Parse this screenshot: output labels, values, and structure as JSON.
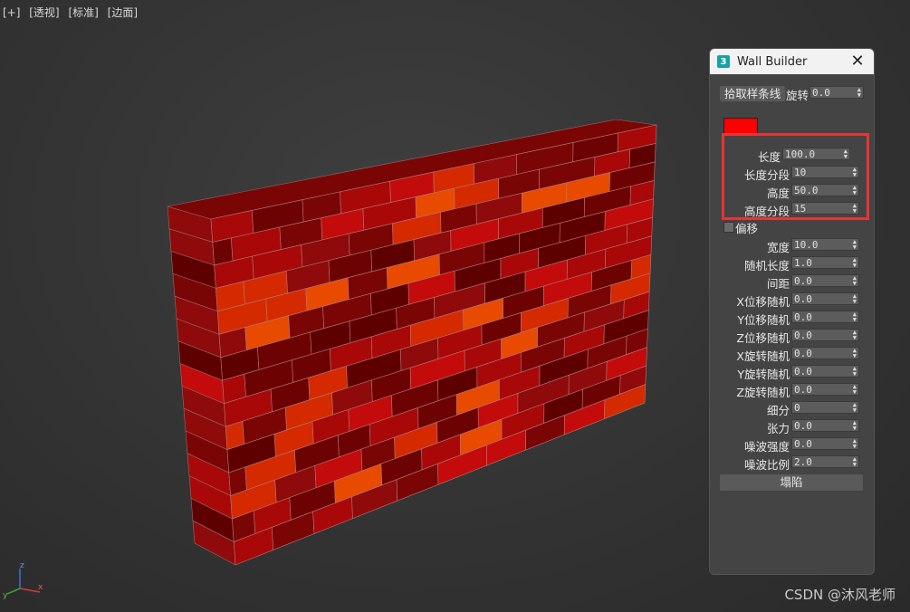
{
  "viewport": {
    "labels": [
      "[+]",
      "[透视]",
      "[标准]",
      "[边面]"
    ]
  },
  "panel": {
    "title": "Wall Builder",
    "app_icon": "3",
    "close_icon": "close-icon",
    "pick_spline_label": "拾取样条线",
    "rotation_label": "旋转",
    "rotation_value": "0.0",
    "swatch_color": "#ff0000",
    "offset_label": "偏移",
    "collapse_label": "塌陷",
    "params": [
      {
        "label": "长度",
        "value": "100.0"
      },
      {
        "label": "长度分段",
        "value": "10"
      },
      {
        "label": "高度",
        "value": "50.0"
      },
      {
        "label": "高度分段",
        "value": "15"
      },
      {
        "label": "宽度",
        "value": "10.0"
      },
      {
        "label": "随机长度",
        "value": "1.0"
      },
      {
        "label": "间距",
        "value": "0.0"
      },
      {
        "label": "X位移随机",
        "value": "0.0"
      },
      {
        "label": "Y位移随机",
        "value": "0.0"
      },
      {
        "label": "Z位移随机",
        "value": "0.0"
      },
      {
        "label": "X旋转随机",
        "value": "0.0"
      },
      {
        "label": "Y旋转随机",
        "value": "0.0"
      },
      {
        "label": "Z旋转随机",
        "value": "0.0"
      },
      {
        "label": "细分",
        "value": "0"
      },
      {
        "label": "张力",
        "value": "0.0"
      },
      {
        "label": "噪波强度",
        "value": "0.0"
      },
      {
        "label": "噪波比例",
        "value": "2.0"
      }
    ]
  },
  "axis": {
    "x": "x",
    "y": "y",
    "z": "z"
  },
  "watermark": "CSDN @沐风老师",
  "colors": {
    "accent": "#e53535",
    "panel_bg": "#444444",
    "swatch": "#ff0000"
  }
}
